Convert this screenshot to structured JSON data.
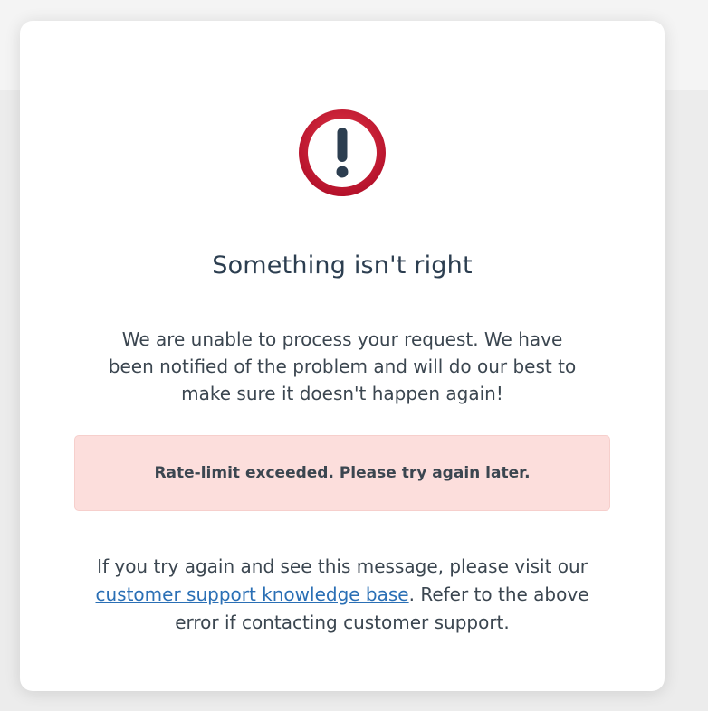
{
  "icon": {
    "name": "exclamation-circle-icon",
    "ring_color": "#c8172f",
    "mark_color": "#2c3e50"
  },
  "title": "Something isn't right",
  "description": "We are unable to process your request. We have been notified of the problem and will do our best to make sure it doesn't happen again!",
  "error": {
    "message": "Rate-limit exceeded. Please try again later.",
    "background": "#fcdedc"
  },
  "footer": {
    "before_link": "If you try again and see this message, please visit our ",
    "link_text": "customer support knowledge base",
    "after_link": ". Refer to the above error if contacting customer support.",
    "link_color": "#2a6fb5"
  }
}
